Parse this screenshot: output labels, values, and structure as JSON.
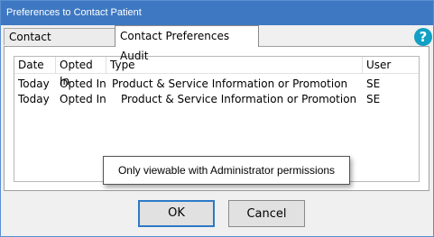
{
  "window": {
    "title": "Preferences to Contact Patient"
  },
  "tabs": [
    {
      "label": "Contact Preferences",
      "active": false
    },
    {
      "label": "Contact Preferences Audit",
      "active": true
    }
  ],
  "help_icon": "question-mark-icon",
  "audit_table": {
    "columns": [
      "Date",
      "Opted In",
      "Type",
      "User"
    ],
    "rows": [
      {
        "date": "Today",
        "opted_in": "Opted In",
        "type": "Product & Service Information or Promotion",
        "user": "SE"
      },
      {
        "date": "Today",
        "opted_in": "Opted In",
        "type": "Product & Service Information or Promotion",
        "user": "SE"
      }
    ]
  },
  "tooltip": {
    "text": "Only viewable with Administrator permissions"
  },
  "buttons": {
    "ok": "OK",
    "cancel": "Cancel"
  },
  "colors": {
    "title_bar": "#3e78c2",
    "help_icon": "#12a0c4",
    "ok_focus_border": "#2d79c7"
  }
}
